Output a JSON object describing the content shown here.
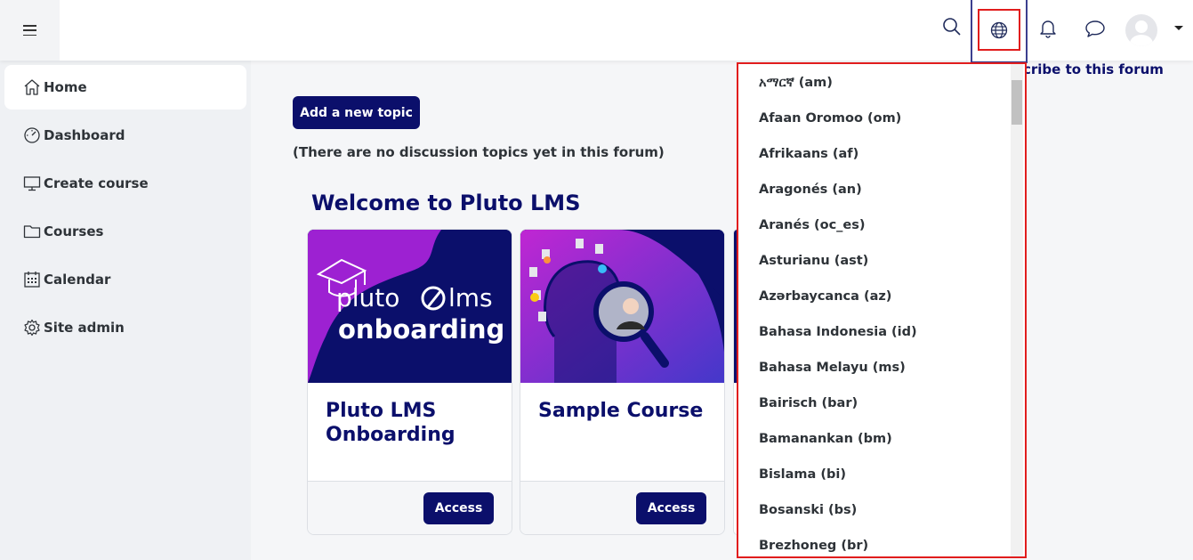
{
  "sidebar": {
    "items": [
      {
        "label": "Home",
        "icon": "home-icon"
      },
      {
        "label": "Dashboard",
        "icon": "dashboard-icon"
      },
      {
        "label": "Create course",
        "icon": "monitor-icon"
      },
      {
        "label": "Courses",
        "icon": "folder-icon"
      },
      {
        "label": "Calendar",
        "icon": "calendar-icon"
      },
      {
        "label": "Site admin",
        "icon": "gear-icon"
      }
    ]
  },
  "forum": {
    "add_topic_label": "Add a new topic",
    "no_topics_text": "(There are no discussion topics yet in this forum)",
    "subscribe_label": "cribe to this forum"
  },
  "welcome": {
    "title": "Welcome to Pluto LMS"
  },
  "courses": [
    {
      "title": "Pluto LMS Onboarding",
      "image_text_1": "pluto",
      "image_text_2": "lms",
      "image_text_3": "onboarding",
      "button": "Access"
    },
    {
      "title": "Sample Course",
      "button": "Access"
    }
  ],
  "language_menu": {
    "items": [
      "አማርኛ (am)",
      "Afaan Oromoo (om)",
      "Afrikaans (af)",
      "Aragonés (an)",
      "Aranés (oc_es)",
      "Asturianu (ast)",
      "Azərbaycanca (az)",
      "Bahasa Indonesia (id)",
      "Bahasa Melayu (ms)",
      "Bairisch (bar)",
      "Bamanankan (bm)",
      "Bislama (bi)",
      "Bosanski (bs)",
      "Brezhoneg (br)"
    ]
  },
  "colors": {
    "brand": "#0b0f6b",
    "highlight": "#e11d1d",
    "card_gradient": "#8b1fd1"
  }
}
